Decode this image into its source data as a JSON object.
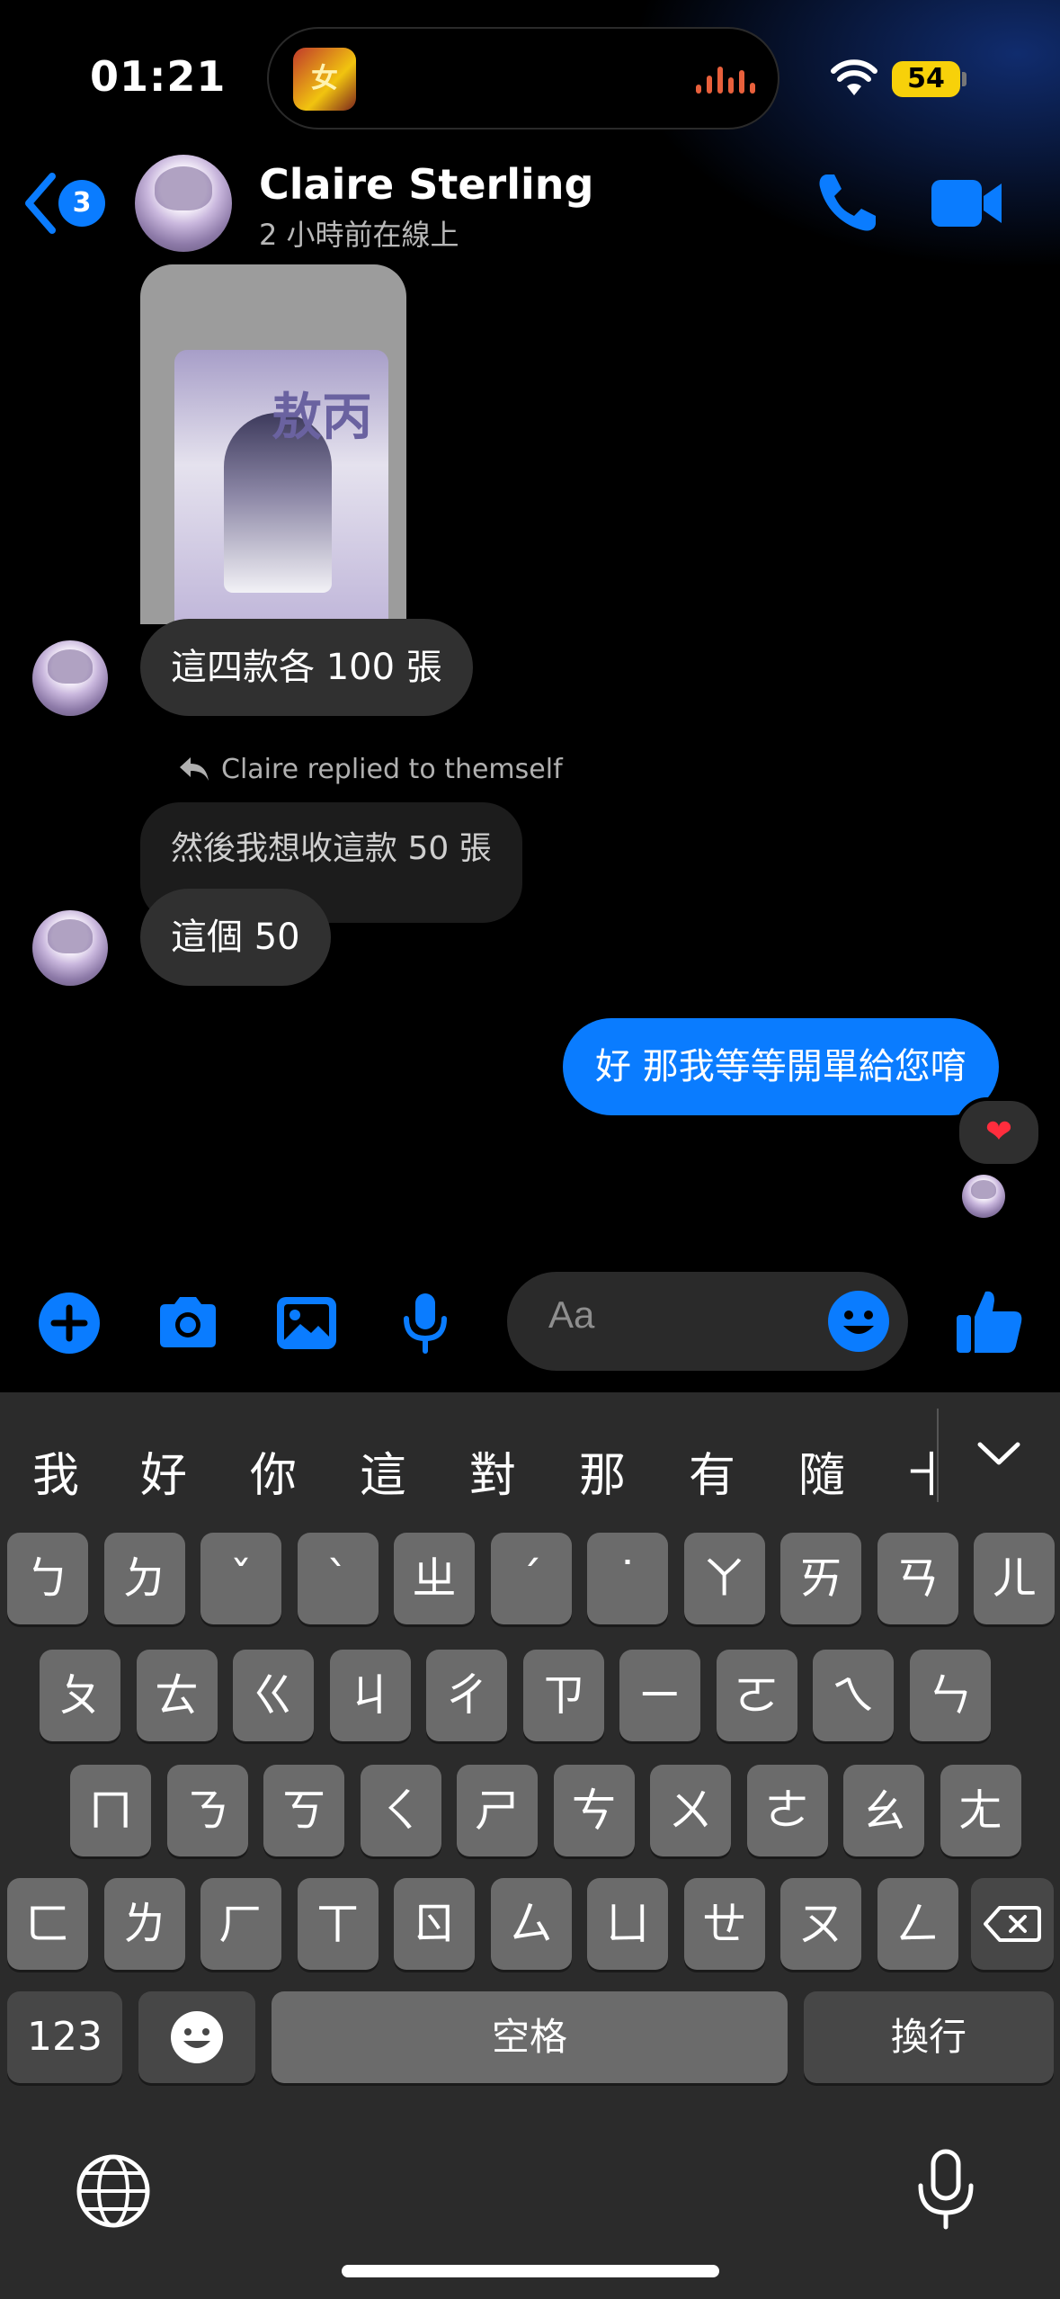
{
  "status_bar": {
    "time": "01:21",
    "battery": "54"
  },
  "header": {
    "back_badge": "3",
    "contact_name": "Claire Sterling",
    "status": "2 小時前在線上"
  },
  "messages": {
    "image_card_title": "敖丙",
    "incoming_1": "這四款各 100 張",
    "reply_note": "Claire replied to themself",
    "quoted_text": "然後我想收這款 50 張",
    "incoming_2": "這個 50",
    "outgoing_1": "好 那我等等開單給您唷",
    "reaction": "❤"
  },
  "composer": {
    "placeholder": "Aa"
  },
  "keyboard": {
    "candidates": [
      "我",
      "好",
      "你",
      "這",
      "對",
      "那",
      "有",
      "隨",
      "十"
    ],
    "row1": [
      "ㄅ",
      "ㄉ",
      "ˇ",
      "ˋ",
      "ㄓ",
      "ˊ",
      "˙",
      "ㄚ",
      "ㄞ",
      "ㄢ",
      "ㄦ"
    ],
    "row2": [
      "ㄆ",
      "ㄊ",
      "ㄍ",
      "ㄐ",
      "ㄔ",
      "ㄗ",
      "ㄧ",
      "ㄛ",
      "ㄟ",
      "ㄣ"
    ],
    "row3": [
      "ㄇ",
      "ㄋ",
      "ㄎ",
      "ㄑ",
      "ㄕ",
      "ㄘ",
      "ㄨ",
      "ㄜ",
      "ㄠ",
      "ㄤ"
    ],
    "row4": [
      "ㄈ",
      "ㄌ",
      "ㄏ",
      "ㄒ",
      "ㄖ",
      "ㄙ",
      "ㄩ",
      "ㄝ",
      "ㄡ",
      "ㄥ"
    ],
    "numbers_label": "123",
    "space_label": "空格",
    "return_label": "換行"
  },
  "colors": {
    "accent": "#0a7cff",
    "incoming_bubble": "#303030",
    "keyboard_bg": "#2b2b2b",
    "key_bg": "#6b6b6b"
  }
}
